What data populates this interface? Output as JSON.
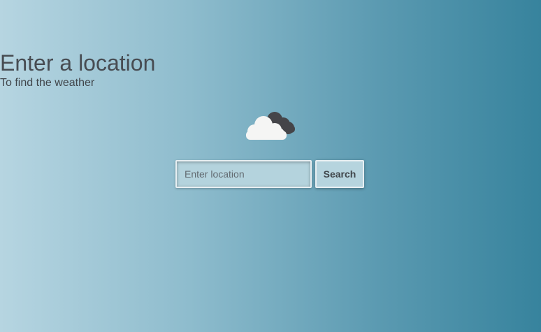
{
  "header": {
    "title": "Enter a location",
    "subtitle": "To find the weather"
  },
  "weather_icon": "cloudy-icon",
  "search": {
    "placeholder": "Enter location",
    "value": "",
    "button_label": "Search"
  },
  "colors": {
    "background_start": "#b6d5e1",
    "background_end": "#37839d",
    "text": "#474c52",
    "input_background": "#b4d3dd",
    "input_border": "#e8eff2",
    "cloud_light": "#f5f5f4",
    "cloud_dark": "#454549"
  }
}
